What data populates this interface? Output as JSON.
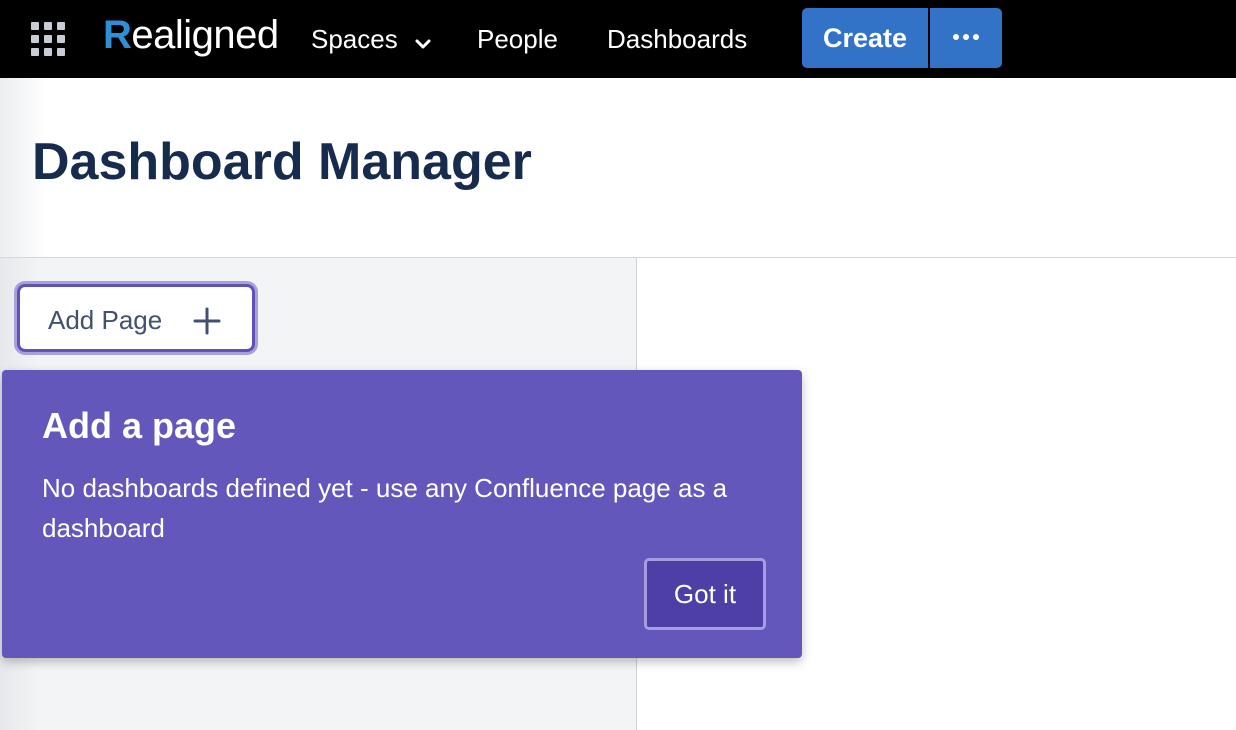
{
  "topbar": {
    "logo": {
      "first_letter": "R",
      "rest": "ealigned"
    },
    "nav": {
      "spaces_label": "Spaces",
      "people_label": "People",
      "dashboards_label": "Dashboards"
    },
    "create_label": "Create",
    "more_label": "More actions"
  },
  "page": {
    "title": "Dashboard Manager"
  },
  "sidebar": {
    "add_page_label": "Add Page"
  },
  "tip": {
    "title": "Add a page",
    "body": "No dashboards defined yet - use any Confluence page as a dashboard",
    "button_label": "Got it"
  },
  "colors": {
    "topbar_bg": "#000000",
    "brand_blue": "#3273c8",
    "logo_accent": "#2f8fd6",
    "tip_purple": "#6357bb",
    "title_navy": "#172b4d"
  },
  "icons": [
    "app-switcher-icon",
    "chevron-down-icon",
    "more-dots-icon",
    "plus-icon"
  ]
}
